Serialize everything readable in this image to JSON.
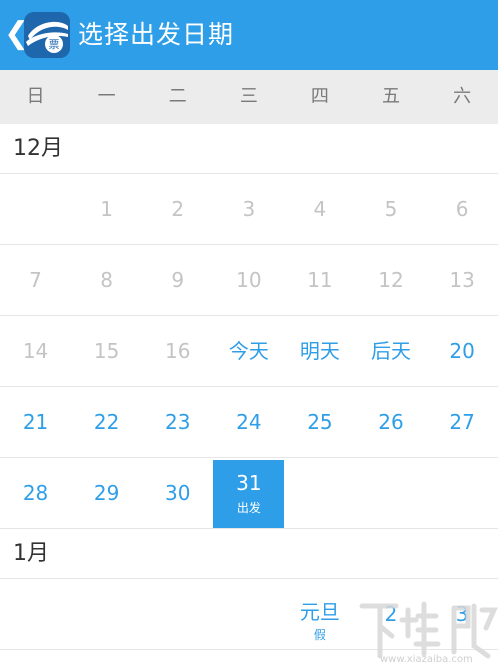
{
  "header": {
    "back_icon": "chevron-left-icon",
    "logo_icon": "ticket-app-logo",
    "logo_text": "票",
    "title": "选择出发日期",
    "bg_color": "#2e9ee8"
  },
  "weekdays": [
    "日",
    "一",
    "二",
    "三",
    "四",
    "五",
    "六"
  ],
  "months": [
    {
      "label": "12月",
      "weeks": [
        [
          {
            "text": "",
            "state": "empty"
          },
          {
            "text": "1",
            "state": "past"
          },
          {
            "text": "2",
            "state": "past"
          },
          {
            "text": "3",
            "state": "past"
          },
          {
            "text": "4",
            "state": "past"
          },
          {
            "text": "5",
            "state": "past"
          },
          {
            "text": "6",
            "state": "past"
          }
        ],
        [
          {
            "text": "7",
            "state": "past"
          },
          {
            "text": "8",
            "state": "past"
          },
          {
            "text": "9",
            "state": "past"
          },
          {
            "text": "10",
            "state": "past"
          },
          {
            "text": "11",
            "state": "past"
          },
          {
            "text": "12",
            "state": "past"
          },
          {
            "text": "13",
            "state": "past"
          }
        ],
        [
          {
            "text": "14",
            "state": "past"
          },
          {
            "text": "15",
            "state": "past"
          },
          {
            "text": "16",
            "state": "past"
          },
          {
            "text": "今天",
            "state": "avail"
          },
          {
            "text": "明天",
            "state": "avail"
          },
          {
            "text": "后天",
            "state": "avail"
          },
          {
            "text": "20",
            "state": "avail"
          }
        ],
        [
          {
            "text": "21",
            "state": "avail"
          },
          {
            "text": "22",
            "state": "avail"
          },
          {
            "text": "23",
            "state": "avail"
          },
          {
            "text": "24",
            "state": "avail"
          },
          {
            "text": "25",
            "state": "avail"
          },
          {
            "text": "26",
            "state": "avail"
          },
          {
            "text": "27",
            "state": "avail"
          }
        ],
        [
          {
            "text": "28",
            "state": "avail"
          },
          {
            "text": "29",
            "state": "avail"
          },
          {
            "text": "30",
            "state": "avail"
          },
          {
            "text": "31",
            "state": "selected",
            "sub": "出发"
          },
          {
            "text": "",
            "state": "empty"
          },
          {
            "text": "",
            "state": "empty"
          },
          {
            "text": "",
            "state": "empty"
          }
        ]
      ]
    },
    {
      "label": "1月",
      "weeks": [
        [
          {
            "text": "",
            "state": "empty"
          },
          {
            "text": "",
            "state": "empty"
          },
          {
            "text": "",
            "state": "empty"
          },
          {
            "text": "",
            "state": "empty"
          },
          {
            "text": "元旦",
            "state": "holiday",
            "sub": "假"
          },
          {
            "text": "2",
            "state": "avail"
          },
          {
            "text": "3",
            "state": "avail"
          }
        ]
      ]
    }
  ],
  "watermark": {
    "text": "下载吧",
    "url": "www.xiazaiba.com"
  }
}
